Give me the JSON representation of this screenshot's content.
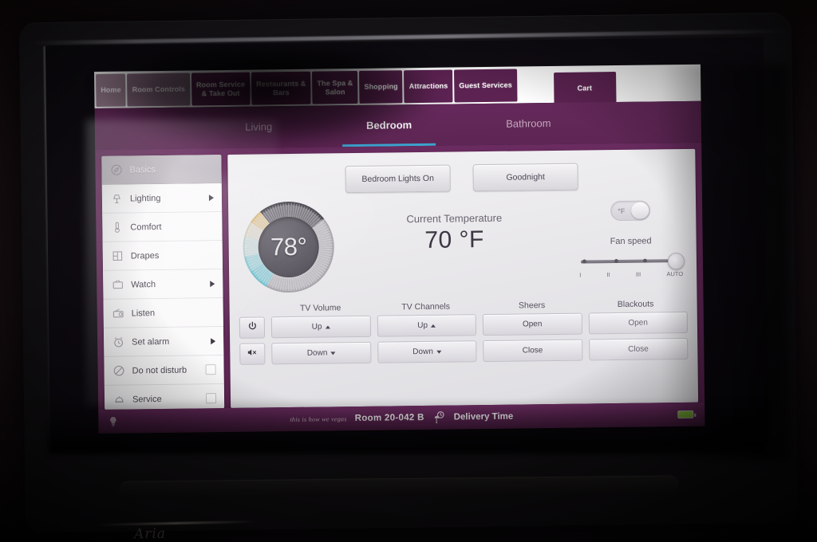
{
  "device": {
    "kind": "in-room-tablet",
    "brand_scribble": "Aria"
  },
  "topnav": {
    "tabs": [
      {
        "label": "Home",
        "line1": "Home",
        "line2": "",
        "state": "washed"
      },
      {
        "label": "Room Controls",
        "line1": "Room Controls",
        "line2": "",
        "state": "active"
      },
      {
        "label": "Room Service & Take Out",
        "line1": "Room Service",
        "line2": "& Take Out",
        "state": "normal"
      },
      {
        "label": "Restaurants & Bars",
        "line1": "Restaurants &",
        "line2": "Bars",
        "state": "normal"
      },
      {
        "label": "The Spa & Salon",
        "line1": "The Spa &",
        "line2": "Salon",
        "state": "normal"
      },
      {
        "label": "Shopping",
        "line1": "Shopping",
        "line2": "",
        "state": "normal"
      },
      {
        "label": "Attractions",
        "line1": "Attractions",
        "line2": "",
        "state": "normal"
      },
      {
        "label": "Guest Services",
        "line1": "Guest Services",
        "line2": "",
        "state": "normal"
      }
    ],
    "cart": {
      "label": "Cart"
    }
  },
  "subnav": {
    "tabs": [
      {
        "label": "Living",
        "active": false
      },
      {
        "label": "Bedroom",
        "active": true
      },
      {
        "label": "Bathroom",
        "active": false
      }
    ],
    "active_underline_color": "#3ba3cf"
  },
  "sidebar": {
    "items": [
      {
        "label": "Basics",
        "icon": "compass-icon",
        "selected": true,
        "arrow": false,
        "checkbox": false
      },
      {
        "label": "Lighting",
        "icon": "lamp-icon",
        "selected": false,
        "arrow": true,
        "checkbox": false
      },
      {
        "label": "Comfort",
        "icon": "thermometer-icon",
        "selected": false,
        "arrow": false,
        "checkbox": false
      },
      {
        "label": "Drapes",
        "icon": "window-icon",
        "selected": false,
        "arrow": false,
        "checkbox": false
      },
      {
        "label": "Watch",
        "icon": "tv-icon",
        "selected": false,
        "arrow": true,
        "checkbox": false
      },
      {
        "label": "Listen",
        "icon": "radio-icon",
        "selected": false,
        "arrow": false,
        "checkbox": false
      },
      {
        "label": "Set alarm",
        "icon": "alarm-clock-icon",
        "selected": false,
        "arrow": true,
        "checkbox": false
      },
      {
        "label": "Do not disturb",
        "icon": "no-entry-icon",
        "selected": false,
        "arrow": false,
        "checkbox": true
      },
      {
        "label": "Service",
        "icon": "bell-icon",
        "selected": false,
        "arrow": false,
        "checkbox": true
      }
    ]
  },
  "scenes": {
    "buttons": [
      {
        "label": "Bedroom Lights On"
      },
      {
        "label": "Goodnight"
      }
    ]
  },
  "climate": {
    "setpoint": "78°",
    "setpoint_value": 78,
    "current_label": "Current Temperature",
    "current_value": "70 °F",
    "current_number": 70,
    "unit_toggle": {
      "label": "°F",
      "position": "right"
    },
    "fan": {
      "label": "Fan speed",
      "ticks": [
        "I",
        "II",
        "III",
        "AUTO"
      ],
      "selected": "AUTO"
    }
  },
  "controls": {
    "headers": [
      "TV Volume",
      "TV Channels",
      "Sheers",
      "Blackouts"
    ],
    "rows": [
      {
        "power_icon": "power-icon",
        "tv_volume": "Up",
        "tv_channels": "Up",
        "sheers": "Open",
        "blackouts": "Open"
      },
      {
        "mute_icon": "mute-icon",
        "tv_volume": "Down",
        "tv_channels": "Down",
        "sheers": "Close",
        "blackouts": "Close"
      }
    ]
  },
  "statusbar": {
    "bulb_icon": "lightbulb-icon",
    "tagline": "this is how we vegas",
    "room": "Room 20-042 B",
    "clock_icon": "delivery-clock-icon",
    "delivery": "Delivery Time",
    "battery_icon": "battery-icon",
    "battery_color": "#8cc63f"
  },
  "theme": {
    "brand_purple": "#5c2352",
    "brand_purple_light": "#6a2c60",
    "accent_blue": "#3ba3cf",
    "panel_gray": "#e8e7ea",
    "sidebar_white": "#f6f4f6"
  }
}
